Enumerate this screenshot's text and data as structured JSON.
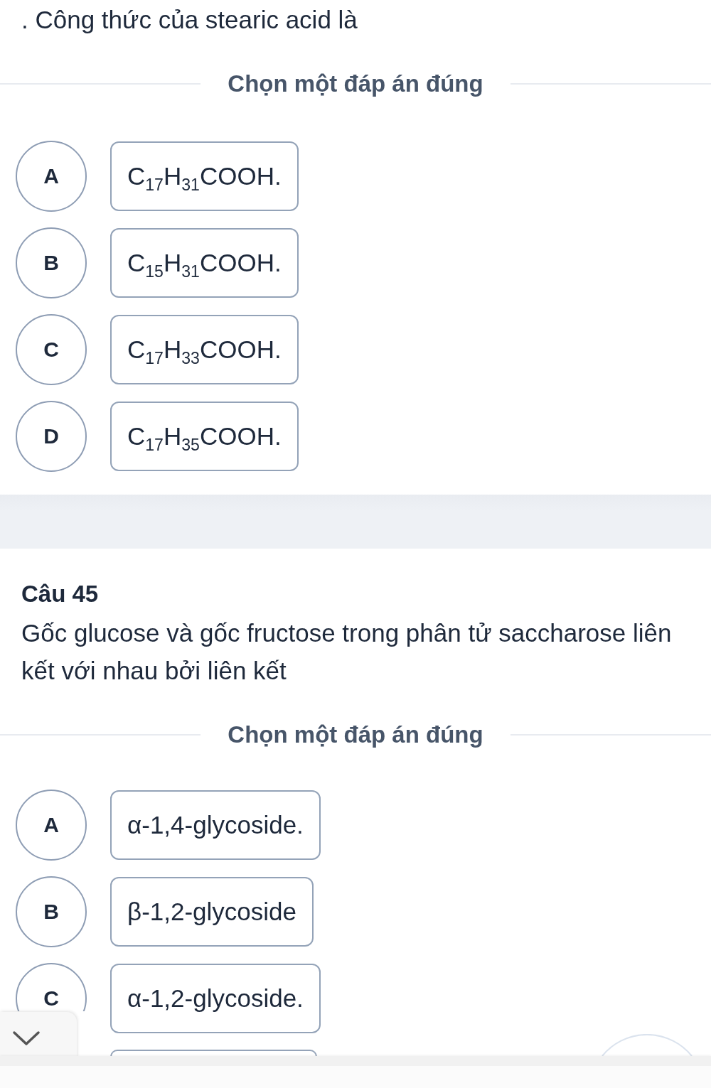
{
  "questions": [
    {
      "text": ". Công thức của stearic acid là",
      "prompt": "Chọn một đáp án đúng",
      "options": [
        {
          "letter": "A",
          "text": "C$_{17}$H$_{31}$COOH.",
          "selected": false
        },
        {
          "letter": "B",
          "text": "C$_{15}$H$_{31}$COOH.",
          "selected": false
        },
        {
          "letter": "C",
          "text": "C$_{17}$H$_{33}$COOH.",
          "selected": false
        },
        {
          "letter": "D",
          "text": "C$_{17}$H$_{35}$COOH.",
          "selected": false
        }
      ]
    },
    {
      "label": "Câu 45",
      "text": "Gốc glucose và gốc fructose trong phân tử saccharose liên kết với nhau bởi liên kết",
      "prompt": "Chọn một đáp án đúng",
      "options": [
        {
          "letter": "A",
          "text": "α-1,4-glycoside.",
          "selected": false
        },
        {
          "letter": "B",
          "text": "β-1,2-glycoside",
          "selected": false
        },
        {
          "letter": "C",
          "text": "α-1,2-glycoside.",
          "selected": false
        }
      ],
      "cut_off_option": true
    }
  ]
}
